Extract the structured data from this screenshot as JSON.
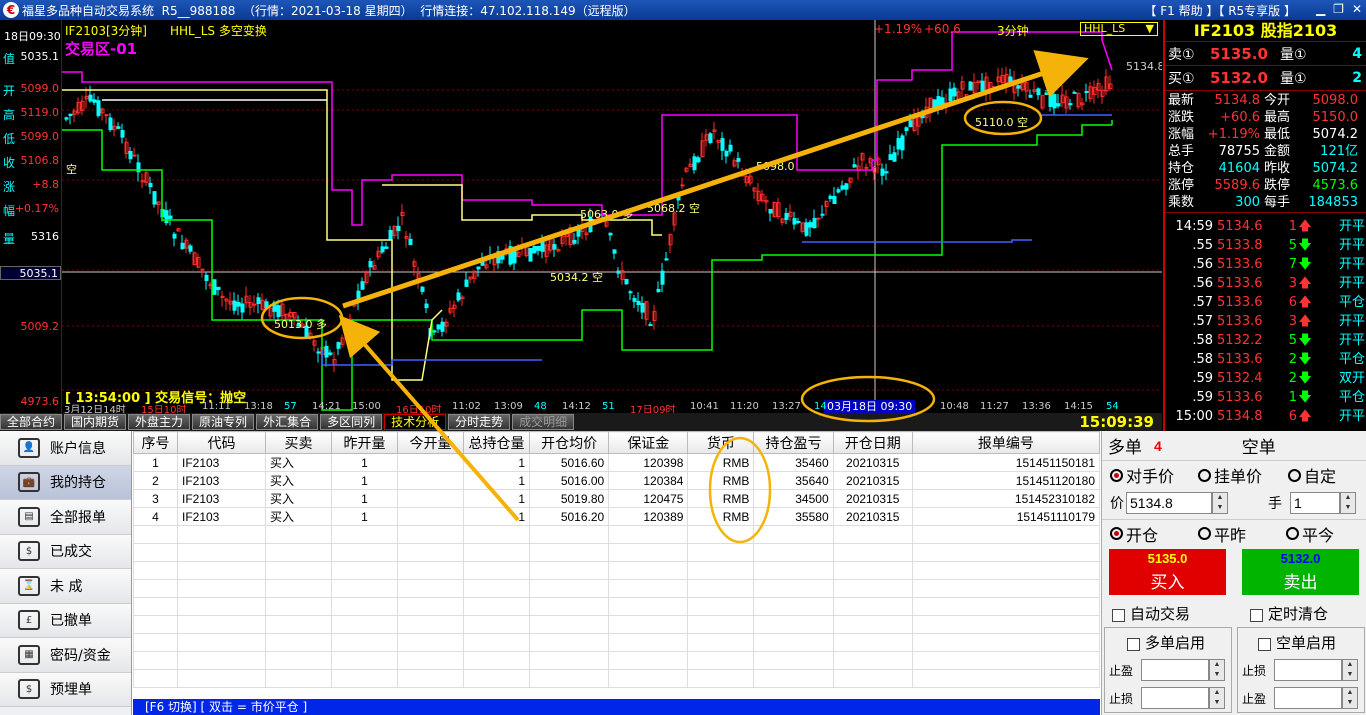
{
  "titlebar": {
    "title": "福星多品种自动交易系统  R5__988188  （行情：2021-03-18 星期四）  行情连接：47.102.118.149（远程版）",
    "help": "【 F1 帮助 】【 R5专享版 】"
  },
  "left_info": {
    "date": "18日09:30",
    "labels": [
      {
        "k": "值",
        "v": "5035.1",
        "c": "#ffffff"
      },
      {
        "k": "开",
        "v": "5099.0",
        "c": "#ff3333"
      },
      {
        "k": "高",
        "v": "5119.0",
        "c": "#ff3333"
      },
      {
        "k": "低",
        "v": "5099.0",
        "c": "#ff3333"
      },
      {
        "k": "收",
        "v": "5106.8",
        "c": "#ff3333"
      },
      {
        "k": "涨",
        "v": "+8.8",
        "c": "#ff3333"
      },
      {
        "k": "幅",
        "v": "+0.17%",
        "c": "#ff3333"
      },
      {
        "k": "量",
        "v": "5316",
        "c": "#ffffff"
      }
    ],
    "price_levels": [
      "5035.1",
      "5009.2",
      "4973.6"
    ]
  },
  "chart": {
    "symbol_label": "IF2103[3分钟]",
    "indicator": "HHL_LS 多空变换",
    "zone": "交易区-01",
    "pct": "+1.19%",
    "chg": "+60.6",
    "period": "3分钟",
    "indicator_box": "HHL_LS",
    "last_price_tag": "5134.8",
    "signal_text": "[ 13:54:00 ] 交易信号：抛空",
    "date_cursor": "03月18日 09:30",
    "annotations": [
      {
        "text": "5013.0 多"
      },
      {
        "text": "5110.0 空"
      },
      {
        "text": "5068.2 空"
      },
      {
        "text": "5063.0 多"
      },
      {
        "text": "5034.2 空"
      },
      {
        "text": "5098.0"
      },
      {
        "text": "空"
      }
    ],
    "time_axis": [
      "3月12日14时",
      "15日10时",
      "11:11",
      "13:18",
      "57",
      "14:21",
      "15:00",
      "16日10时",
      "11:02",
      "13:09",
      "48",
      "14:12",
      "51",
      "17日09时",
      "10:41",
      "11:20",
      "13:27",
      "14",
      "10:48",
      "11:27",
      "13:36",
      "14:15",
      "54"
    ]
  },
  "tabs": [
    {
      "label": "全部合约",
      "state": "normal"
    },
    {
      "label": "国内期货",
      "state": "normal"
    },
    {
      "label": "外盘主力",
      "state": "normal"
    },
    {
      "label": "原油专列",
      "state": "normal"
    },
    {
      "label": "外汇集合",
      "state": "normal"
    },
    {
      "label": "多区同列",
      "state": "normal"
    },
    {
      "label": "技术分析",
      "state": "active"
    },
    {
      "label": "分时走势",
      "state": "normal"
    },
    {
      "label": "成交明细",
      "state": "dim"
    }
  ],
  "clock": "15:09:39",
  "quote": {
    "title": "IF2103 股指2103",
    "sell": {
      "label": "卖①",
      "price": "5135.0",
      "qlabel": "量①",
      "qty": "4"
    },
    "buy": {
      "label": "买①",
      "price": "5132.0",
      "qlabel": "量①",
      "qty": "2"
    },
    "grid": [
      [
        "最新",
        "5134.8",
        "#ff3333",
        "今开",
        "5098.0",
        "#ff3333"
      ],
      [
        "涨跌",
        "+60.6",
        "#ff3333",
        "最高",
        "5150.0",
        "#ff3333"
      ],
      [
        "涨幅",
        "+1.19%",
        "#ff3333",
        "最低",
        "5074.2",
        "#ffffff"
      ],
      [
        "总手",
        "78755",
        "#ffffff",
        "金额",
        "121亿",
        "#00ffff"
      ],
      [
        "持仓",
        "41604",
        "#00ffff",
        "昨收",
        "5074.2",
        "#00ffff"
      ],
      [
        "涨停",
        "5589.6",
        "#ff3333",
        "跌停",
        "4573.6",
        "#00ff00"
      ],
      [
        "乘数",
        "300",
        "#00ffff",
        "每手",
        "184853",
        "#00ffff"
      ]
    ],
    "ticks": [
      {
        "t": "14:59",
        "p": "5134.6",
        "v": "1",
        "dir": "up",
        "type": "开平"
      },
      {
        "t": ".55",
        "p": "5133.8",
        "v": "5",
        "dir": "down",
        "type": "开平"
      },
      {
        "t": ".56",
        "p": "5133.6",
        "v": "7",
        "dir": "down",
        "type": "开平"
      },
      {
        "t": ".56",
        "p": "5133.6",
        "v": "3",
        "dir": "up",
        "type": "开平"
      },
      {
        "t": ".57",
        "p": "5133.6",
        "v": "6",
        "dir": "up",
        "type": "平仓"
      },
      {
        "t": ".57",
        "p": "5133.6",
        "v": "3",
        "dir": "up",
        "type": "开平"
      },
      {
        "t": ".58",
        "p": "5132.2",
        "v": "5",
        "dir": "down",
        "type": "开平"
      },
      {
        "t": ".58",
        "p": "5133.6",
        "v": "2",
        "dir": "down",
        "type": "平仓"
      },
      {
        "t": ".59",
        "p": "5132.4",
        "v": "2",
        "dir": "down",
        "type": "双开"
      },
      {
        "t": ".59",
        "p": "5133.6",
        "v": "1",
        "dir": "down",
        "type": "平仓"
      },
      {
        "t": "15:00",
        "p": "5134.8",
        "v": "6",
        "dir": "up",
        "type": "开平"
      }
    ]
  },
  "sidebar": [
    {
      "label": "账户信息",
      "icon": "user-icon"
    },
    {
      "label": "我的持仓",
      "icon": "position-icon",
      "selected": true
    },
    {
      "label": "全部报单",
      "icon": "orders-icon"
    },
    {
      "label": "已成交",
      "icon": "filled-icon"
    },
    {
      "label": "未 成",
      "icon": "pending-icon"
    },
    {
      "label": "已撤单",
      "icon": "cancelled-icon"
    },
    {
      "label": "密码/资金",
      "icon": "password-icon"
    },
    {
      "label": "预埋单",
      "icon": "preorder-icon"
    }
  ],
  "positions": {
    "columns": [
      "序号",
      "代码",
      "买卖",
      "昨开量",
      "今开量",
      "总持仓量",
      "开仓均价",
      "保证金",
      "货币",
      "持仓盈亏",
      "开仓日期",
      "报单编号"
    ],
    "rows": [
      [
        "1",
        "IF2103",
        "买入",
        "1",
        "",
        "1",
        "5016.60",
        "120398",
        "RMB",
        "35460",
        "20210315",
        "151451150181"
      ],
      [
        "2",
        "IF2103",
        "买入",
        "1",
        "",
        "1",
        "5016.00",
        "120384",
        "RMB",
        "35640",
        "20210315",
        "151451120180"
      ],
      [
        "3",
        "IF2103",
        "买入",
        "1",
        "",
        "1",
        "5019.80",
        "120475",
        "RMB",
        "34500",
        "20210315",
        "151452310182"
      ],
      [
        "4",
        "IF2103",
        "买入",
        "1",
        "",
        "1",
        "5016.20",
        "120389",
        "RMB",
        "35580",
        "20210315",
        "151451110179"
      ]
    ],
    "footer": "[F6 切换] [ 双击 = 市价平仓 ]"
  },
  "order": {
    "long_label": "多单",
    "long_count": "4",
    "short_label": "空单",
    "price_types": [
      "对手价",
      "挂单价",
      "自定"
    ],
    "price_label": "价",
    "price_value": "5134.8",
    "qty_label": "手",
    "qty_value": "1",
    "open_types": [
      "开仓",
      "平昨",
      "平今"
    ],
    "buy_price": "5135.0",
    "buy_label": "买入",
    "sell_price": "5132.0",
    "sell_label": "卖出",
    "auto_trade": "自动交易",
    "timed_clear": "定时清仓",
    "long_enable": "多单启用",
    "short_enable": "空单启用",
    "tp_label": "止盈",
    "sl_label": "止损"
  }
}
